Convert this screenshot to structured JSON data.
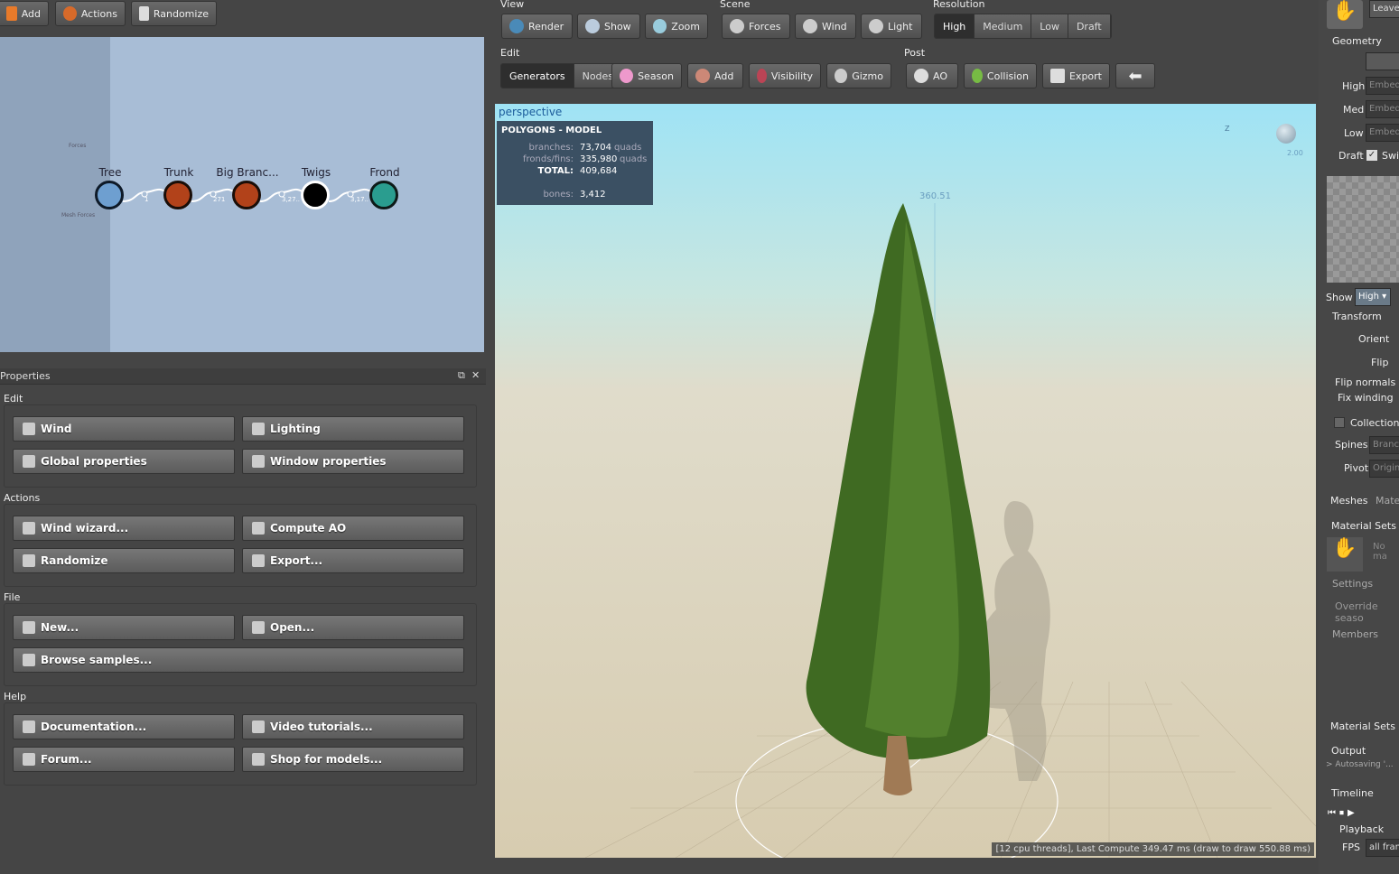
{
  "top_left_toolbar": {
    "add": "Add",
    "actions": "Actions",
    "randomize": "Randomize"
  },
  "node_graph": {
    "nodes": [
      {
        "label": "Tree"
      },
      {
        "label": "Trunk"
      },
      {
        "label": "Big Branc..."
      },
      {
        "label": "Twigs"
      },
      {
        "label": "Frond"
      }
    ],
    "links": [
      "1",
      "271",
      "3,27..",
      "3,17.."
    ],
    "side_labels": {
      "forces": "Forces",
      "mesh_forces": "Mesh Forces"
    }
  },
  "properties": {
    "title": "Properties",
    "sections": [
      {
        "title": "Edit",
        "buttons": [
          "Wind",
          "Lighting",
          "Global properties",
          "Window properties"
        ]
      },
      {
        "title": "Actions",
        "buttons": [
          "Wind wizard...",
          "Compute AO",
          "Randomize",
          "Export..."
        ]
      },
      {
        "title": "File",
        "buttons": [
          "New...",
          "Open...",
          "Browse samples..."
        ]
      },
      {
        "title": "Help",
        "buttons": [
          "Documentation...",
          "Video tutorials...",
          "Forum...",
          "Shop for models..."
        ]
      }
    ]
  },
  "toolbar": {
    "view": {
      "label": "View",
      "buttons": [
        "Render",
        "Show",
        "Zoom"
      ]
    },
    "scene": {
      "label": "Scene",
      "buttons": [
        "Forces",
        "Wind",
        "Light"
      ]
    },
    "resolution": {
      "label": "Resolution",
      "options": [
        "High",
        "Medium",
        "Low",
        "Draft"
      ],
      "selected": "High"
    },
    "edit": {
      "label": "Edit",
      "tabs": [
        "Generators",
        "Nodes"
      ],
      "buttons": [
        "Season",
        "Add",
        "Visibility",
        "Gizmo"
      ]
    },
    "post": {
      "label": "Post",
      "buttons": [
        "AO",
        "Collision",
        "Export"
      ]
    }
  },
  "viewport": {
    "mode": "perspective",
    "stats": {
      "title": "POLYGONS - MODEL",
      "branches_label": "branches:",
      "branches": "73,704",
      "fronds_label": "fronds/fins:",
      "fronds": "335,980",
      "unit": "quads",
      "total_label": "TOTAL:",
      "total": "409,684",
      "bones_label": "bones:",
      "bones": "3,412"
    },
    "height_readout": "360.51",
    "axis_label": "Z",
    "light_value": "2.00",
    "status": "[12 cpu threads], Last Compute 349.47 ms (draw to draw 550.88 ms)"
  },
  "right_panel": {
    "leaves": "Leave",
    "geometry": "Geometry",
    "high": "High",
    "med": "Med",
    "low": "Low",
    "embed": "Embed",
    "draft": "Draft",
    "switch": "Swi",
    "show": "Show",
    "show_value": "High",
    "transform": "Transform",
    "orient": "Orient",
    "flip": "Flip",
    "flip_normals": "Flip normals",
    "fix_winding": "Fix winding",
    "collection": "Collection",
    "spines": "Spines",
    "spines_value": "Branc",
    "pivot": "Pivot",
    "pivot_value": "Origin",
    "meshes": "Meshes",
    "mate": "Mate",
    "material_sets": "Material Sets",
    "no_ma": "No ma",
    "settings": "Settings",
    "override": "Override seaso",
    "members": "Members",
    "material_sets2": "Material Sets",
    "output": "Output",
    "autosaving": "> Autosaving '...",
    "timeline": "Timeline",
    "playback": "Playback",
    "fps": "FPS",
    "fps_value": "all fram"
  }
}
